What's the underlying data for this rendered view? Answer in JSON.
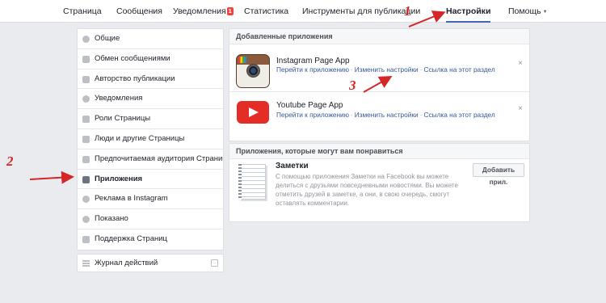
{
  "topnav": {
    "tabs": [
      {
        "label": "Страница"
      },
      {
        "label": "Сообщения"
      },
      {
        "label": "Уведомления",
        "badge": "1"
      },
      {
        "label": "Статистика"
      },
      {
        "label": "Инструменты для публикации"
      },
      {
        "label": "Настройки",
        "active": true
      },
      {
        "label": "Помощь",
        "caret": "▼"
      }
    ]
  },
  "sidebar": {
    "items": [
      {
        "label": "Общие",
        "icon": "gear-icon"
      },
      {
        "label": "Обмен сообщениями",
        "icon": "chat-icon"
      },
      {
        "label": "Авторство публикации",
        "icon": "flag-icon"
      },
      {
        "label": "Уведомления",
        "icon": "globe-icon"
      },
      {
        "label": "Роли Страницы",
        "icon": "person-icon"
      },
      {
        "label": "Люди и другие Страницы",
        "icon": "people-icon"
      },
      {
        "label": "Предпочитаемая аудитория Страницы",
        "icon": "audience-icon"
      },
      {
        "label": "Приложения",
        "icon": "cube-icon",
        "active": true
      },
      {
        "label": "Реклама в Instagram",
        "icon": "instagram-icon"
      },
      {
        "label": "Показано",
        "icon": "star-icon"
      },
      {
        "label": "Поддержка Страниц",
        "icon": "facebook-icon"
      }
    ],
    "activity_log": "Журнал действий"
  },
  "added_apps": {
    "heading": "Добавленные приложения",
    "apps": [
      {
        "title": "Instagram Page App",
        "links": [
          "Перейти к приложению",
          "Изменить настройки",
          "Ссылка на этот раздел"
        ],
        "close": "×"
      },
      {
        "title": "Youtube Page App",
        "links": [
          "Перейти к приложению",
          "Изменить настройки",
          "Ссылка на этот раздел"
        ],
        "close": "×"
      }
    ],
    "separator": "·"
  },
  "suggested": {
    "heading": "Приложения, которые могут вам понравиться",
    "title": "Заметки",
    "description": "С помощью приложения Заметки на Facebook вы можете делиться с друзьями повседневными новостями. Вы можете отметить друзей в заметке, а они, в свою очередь, смогут оставлять комментарии.",
    "button": "Добавить прил."
  },
  "annotations": {
    "one": "1",
    "two": "2",
    "three": "3",
    "color": "#d42727"
  },
  "colors": {
    "link": "#365899",
    "active_tab_underline": "#4267b2",
    "badge": "#fa3e3e"
  }
}
